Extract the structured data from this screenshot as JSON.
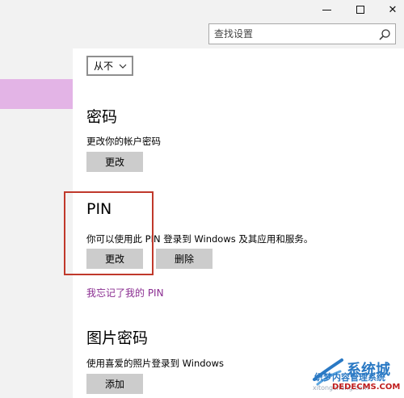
{
  "window": {
    "minimize_icon": "minimize-icon",
    "maximize_icon": "maximize-icon",
    "close_symbol": "✕"
  },
  "search": {
    "placeholder": "查找设置",
    "icon": "search-icon"
  },
  "sidebar": {
    "selected_color": "#e3b4e6"
  },
  "main": {
    "require_signin_dropdown": {
      "selected": "从不",
      "icon": "chevron-down-icon"
    },
    "password": {
      "title": "密码",
      "description": "更改你的帐户密码",
      "change_label": "更改"
    },
    "pin": {
      "title": "PIN",
      "description": "你可以使用此 PIN 登录到 Windows 及其应用和服务。",
      "change_label": "更改",
      "remove_label": "删除",
      "forgot_link": "我忘记了我的 PIN"
    },
    "picture_password": {
      "title": "图片密码",
      "description": "使用喜爱的照片登录到 Windows",
      "add_label": "添加"
    }
  },
  "colors": {
    "accent_link": "#8a2d91",
    "highlight_border": "#c0392b",
    "button_bg": "#cccccc"
  },
  "watermark": {
    "brand": "系统城",
    "line1": "织梦内容管理系统",
    "line2": "DEDECMS.COM",
    "sub": "xitongcheng.com"
  }
}
